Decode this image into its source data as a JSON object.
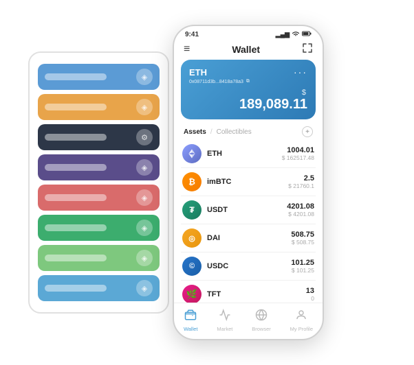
{
  "scene": {
    "card_stack": {
      "rows": [
        {
          "color": "card-blue",
          "icon": "◈"
        },
        {
          "color": "card-orange",
          "icon": "◈"
        },
        {
          "color": "card-dark",
          "icon": "⚙"
        },
        {
          "color": "card-purple",
          "icon": "◈"
        },
        {
          "color": "card-red",
          "icon": "◈"
        },
        {
          "color": "card-green",
          "icon": "◈"
        },
        {
          "color": "card-lightgreen",
          "icon": "◈"
        },
        {
          "color": "card-lightblue",
          "icon": "◈"
        }
      ]
    }
  },
  "status_bar": {
    "time": "9:41",
    "signal": "▂▄▆",
    "wifi": "WiFi",
    "battery": "🔋"
  },
  "header": {
    "menu_icon": "≡",
    "title": "Wallet",
    "expand_icon": "⛶"
  },
  "eth_card": {
    "title": "ETH",
    "dots": "···",
    "address": "0x08711d3b...8418a78a3",
    "copy_icon": "⧉",
    "currency_symbol": "$",
    "amount": "189,089.11"
  },
  "assets_section": {
    "tab_active": "Assets",
    "divider": "/",
    "tab_inactive": "Collectibles",
    "add_icon": "+"
  },
  "assets": [
    {
      "name": "ETH",
      "icon_label": "◆",
      "icon_class": "eth-icon",
      "amount": "1004.01",
      "usd": "$ 162517.48"
    },
    {
      "name": "imBTC",
      "icon_label": "₿",
      "icon_class": "imbtc-icon",
      "amount": "2.5",
      "usd": "$ 21760.1"
    },
    {
      "name": "USDT",
      "icon_label": "₮",
      "icon_class": "usdt-icon",
      "amount": "4201.08",
      "usd": "$ 4201.08"
    },
    {
      "name": "DAI",
      "icon_label": "◎",
      "icon_class": "dai-icon",
      "amount": "508.75",
      "usd": "$ 508.75"
    },
    {
      "name": "USDC",
      "icon_label": "©",
      "icon_class": "usdc-icon",
      "amount": "101.25",
      "usd": "$ 101.25"
    },
    {
      "name": "TFT",
      "icon_label": "🌿",
      "icon_class": "tft-icon",
      "amount": "13",
      "usd": "0"
    }
  ],
  "bottom_nav": [
    {
      "icon": "◉",
      "label": "Wallet",
      "active": true
    },
    {
      "icon": "📈",
      "label": "Market",
      "active": false
    },
    {
      "icon": "🌐",
      "label": "Browser",
      "active": false
    },
    {
      "icon": "👤",
      "label": "My Profile",
      "active": false
    }
  ]
}
